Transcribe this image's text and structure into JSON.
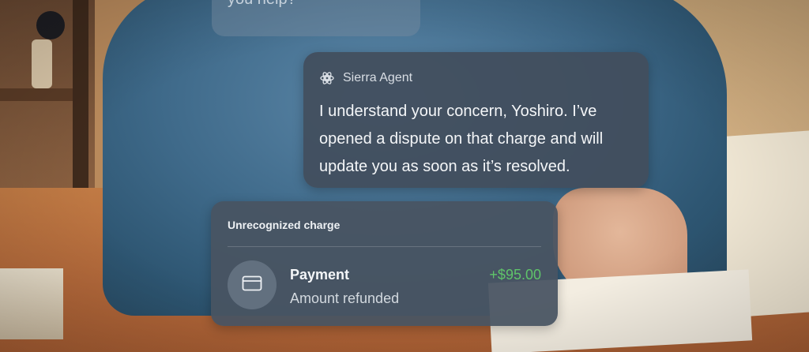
{
  "previous_message": {
    "text": "you help?"
  },
  "agent_message": {
    "sender_name": "Sierra Agent",
    "sender_icon": "sierra-logo-icon",
    "text": "I understand your concern, Yoshiro. I’ve opened a dispute on that charge and will update you as soon as it’s resolved."
  },
  "charge_card": {
    "title": "Unrecognized charge",
    "item": {
      "icon": "credit-card-icon",
      "label": "Payment",
      "sublabel": "Amount refunded",
      "amount": "+$95.00",
      "amount_color": "#5fc46a"
    }
  }
}
